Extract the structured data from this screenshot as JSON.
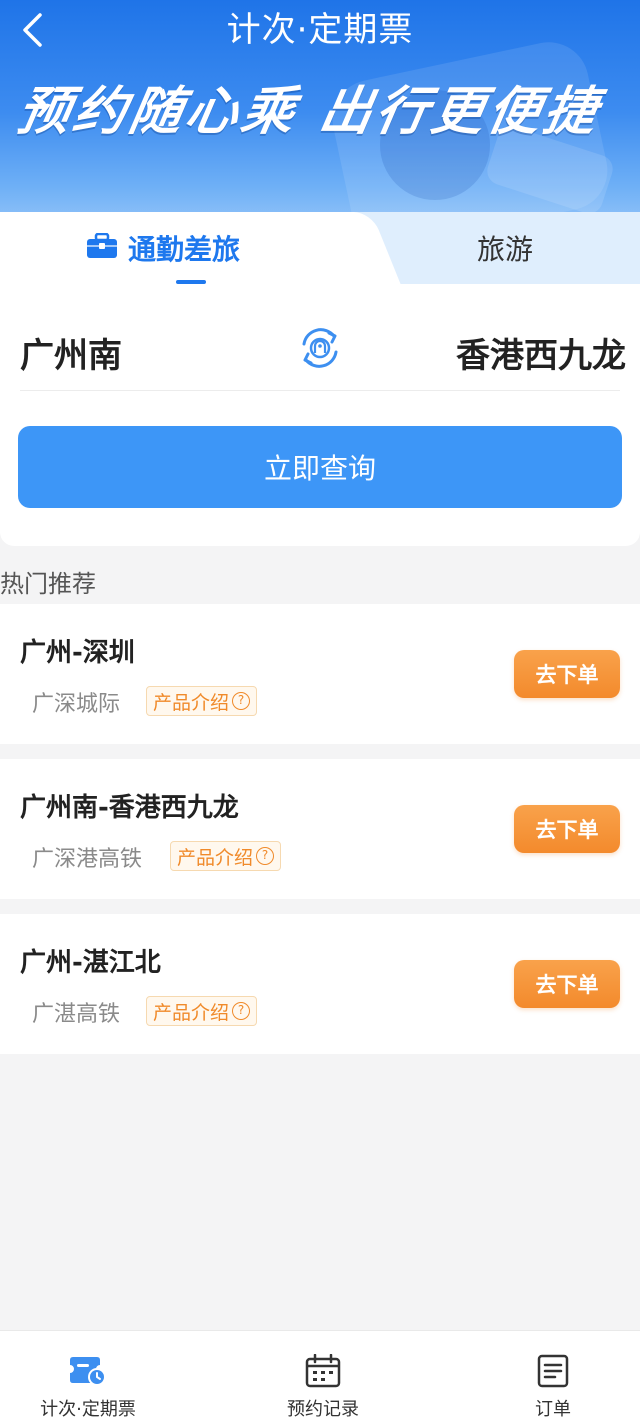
{
  "header": {
    "title": "计次·定期票",
    "slogan": "预约随心乘 出行更便捷"
  },
  "tabs": [
    {
      "label": "通勤差旅",
      "active": true
    },
    {
      "label": "旅游",
      "active": false
    }
  ],
  "search": {
    "from": "广州南",
    "to": "香港西九龙",
    "button_label": "立即查询"
  },
  "hot": {
    "title": "热门推荐",
    "intro_label": "产品介绍",
    "order_label": "去下单",
    "routes": [
      {
        "name": "广州-深圳",
        "type": "广深城际"
      },
      {
        "name": "广州南-香港西九龙",
        "type": "广深港高铁"
      },
      {
        "name": "广州-湛江北",
        "type": "广湛高铁"
      }
    ]
  },
  "bottom_nav": [
    {
      "label": "计次·定期票",
      "icon": "ticket-clock-icon",
      "active": true
    },
    {
      "label": "预约记录",
      "icon": "calendar-icon",
      "active": false
    },
    {
      "label": "订单",
      "icon": "document-icon",
      "active": false
    }
  ],
  "colors": {
    "primary": "#1e78ee",
    "search_button": "#3d96f7",
    "order_button": "#f38a2c",
    "intro_tag_text": "#f08a2a"
  }
}
